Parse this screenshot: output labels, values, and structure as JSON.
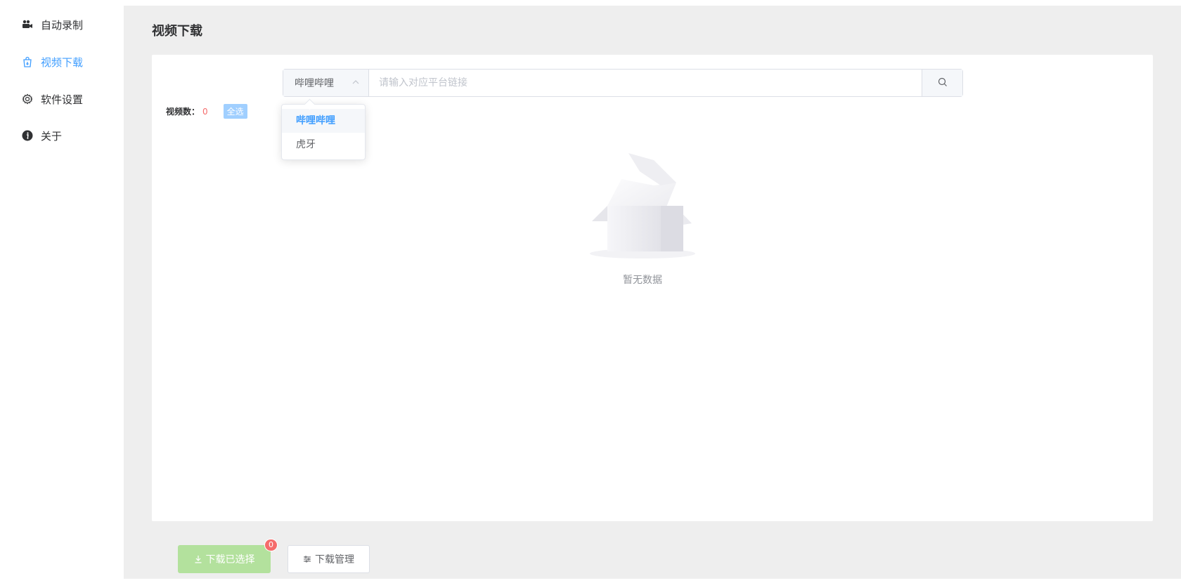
{
  "sidebar": {
    "items": [
      {
        "label": "自动录制",
        "icon": "video-camera-icon",
        "active": false
      },
      {
        "label": "视频下载",
        "icon": "download-bag-icon",
        "active": true
      },
      {
        "label": "软件设置",
        "icon": "gear-icon",
        "active": false
      },
      {
        "label": "关于",
        "icon": "info-icon",
        "active": false
      }
    ]
  },
  "main": {
    "title": "视频下载",
    "search": {
      "platform": "哔哩哔哩",
      "placeholder": "请输入对应平台链接",
      "value": ""
    },
    "count": {
      "label": "视频数：",
      "value": "0",
      "select_all": "全选"
    },
    "dropdown": {
      "options": [
        "哔哩哔哩",
        "虎牙"
      ],
      "selected": "哔哩哔哩"
    },
    "empty": {
      "text": "暂无数据"
    },
    "actions": {
      "download_selected": "下载已选择",
      "badge": "0",
      "download_manage": "下载管理"
    }
  },
  "colors": {
    "accent": "#409eff",
    "danger": "#f56c6c",
    "success_disabled": "#b3e19d",
    "background": "#eeeeee"
  }
}
